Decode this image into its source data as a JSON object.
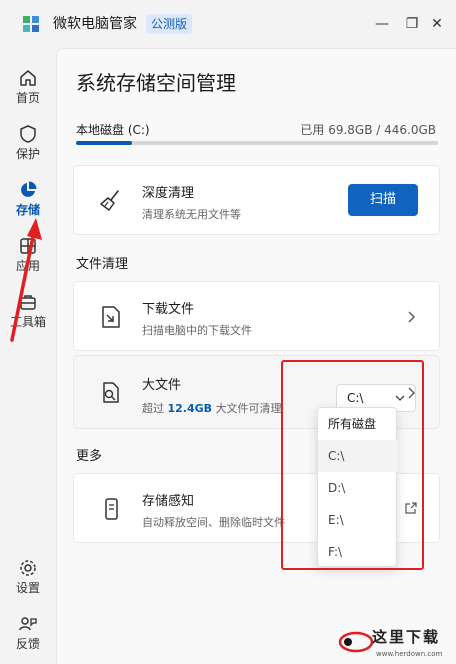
{
  "app": {
    "title": "微软电脑管家",
    "badge": "公测版"
  },
  "window_controls": {
    "minimize": "—",
    "maximize": "❐",
    "close": "✕"
  },
  "sidebar": {
    "items": [
      {
        "label": "首页",
        "icon": "home-icon"
      },
      {
        "label": "保护",
        "icon": "shield-icon"
      },
      {
        "label": "存储",
        "icon": "pie-chart-icon",
        "active": true
      },
      {
        "label": "应用",
        "icon": "apps-icon"
      },
      {
        "label": "工具箱",
        "icon": "toolbox-icon"
      }
    ],
    "bottom_items": [
      {
        "label": "设置",
        "icon": "gear-icon"
      },
      {
        "label": "反馈",
        "icon": "feedback-icon"
      }
    ]
  },
  "main": {
    "title": "系统存储空间管理",
    "disk": {
      "name": "本地磁盘 (C:)",
      "usage": "已用 69.8GB / 446.0GB",
      "used_fraction": 0.156
    },
    "deep_clean": {
      "title": "深度清理",
      "desc": "清理系统无用文件等",
      "button": "扫描"
    },
    "file_clean_section": "文件清理",
    "downloads": {
      "title": "下载文件",
      "desc": "扫描电脑中的下载文件"
    },
    "large_files": {
      "title": "大文件",
      "desc_prefix": "超过",
      "desc_highlight": "12.4GB",
      "desc_suffix": "大文件可清理",
      "selected_drive": "C:\\"
    },
    "more_section": "更多",
    "storage_sense": {
      "title": "存储感知",
      "desc": "自动释放空间、删除临时文件"
    }
  },
  "dropdown": {
    "options": [
      "所有磁盘",
      "C:\\",
      "D:\\",
      "E:\\",
      "F:\\"
    ],
    "selected_index": 1
  },
  "colors": {
    "accent": "#0a5ab4",
    "button": "#1064c0",
    "annotation": "#e02020"
  },
  "watermark": {
    "text": "这里下载",
    "url": "www.herdown.com"
  }
}
